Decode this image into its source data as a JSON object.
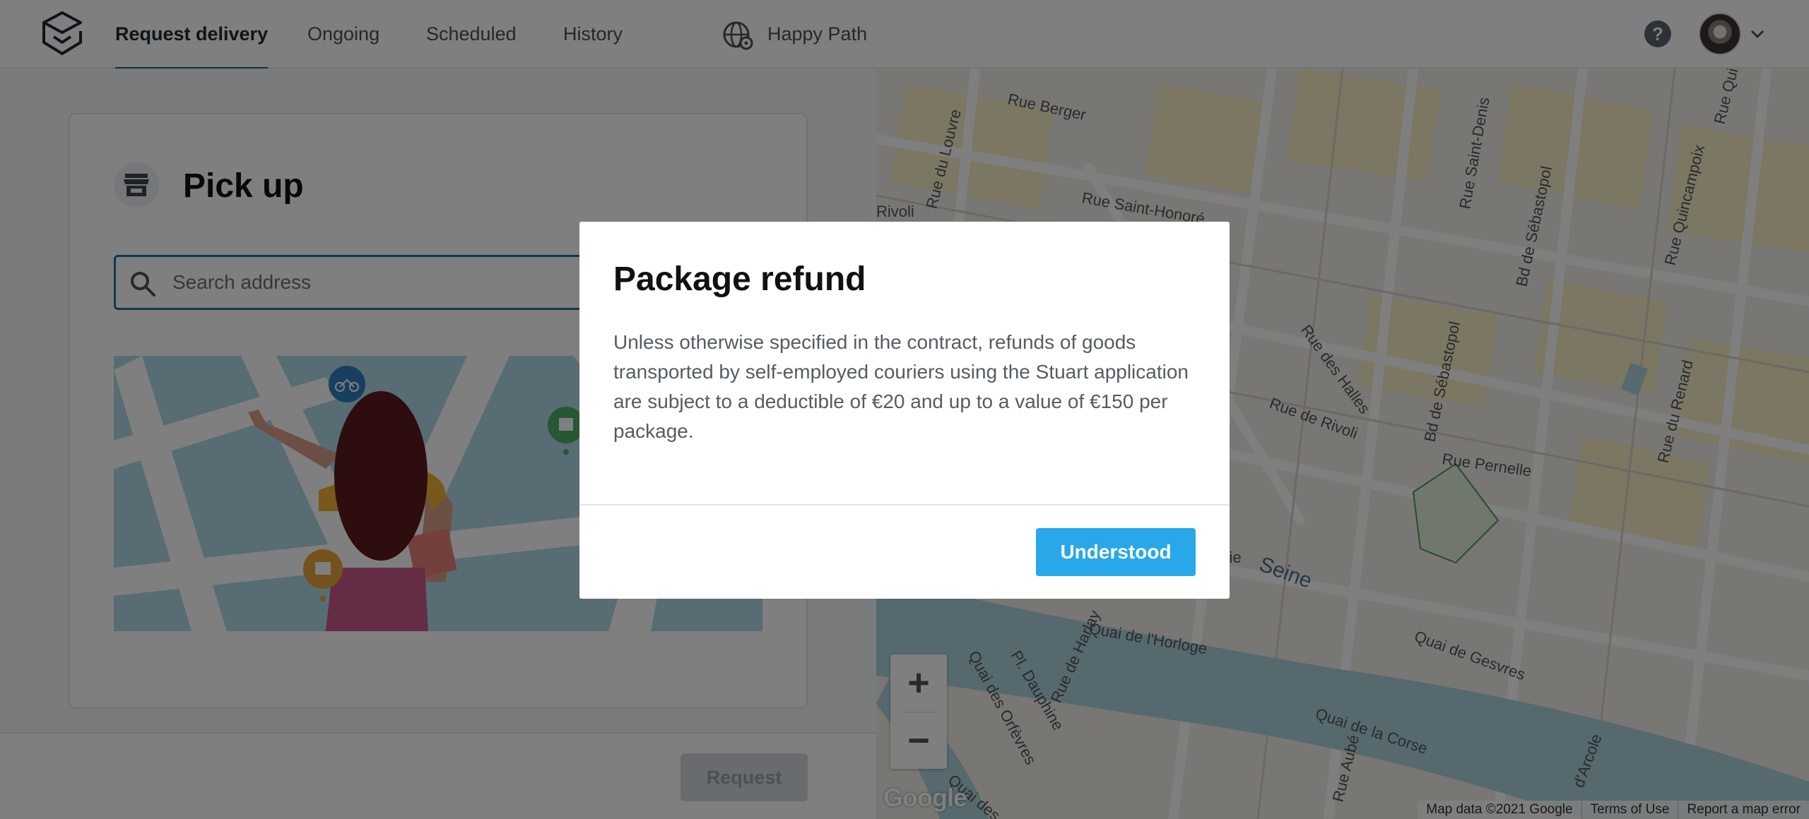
{
  "nav": {
    "tabs": [
      {
        "label": "Request delivery",
        "active": true
      },
      {
        "label": "Ongoing",
        "active": false
      },
      {
        "label": "Scheduled",
        "active": false
      },
      {
        "label": "History",
        "active": false
      }
    ],
    "account_label": "Happy Path",
    "help_label": "?"
  },
  "pickup": {
    "title": "Pick up",
    "search_placeholder": "Search address"
  },
  "footer": {
    "request_label": "Request"
  },
  "map": {
    "zoom_in": "+",
    "zoom_out": "−",
    "google_label": "Google",
    "attribution": [
      "Map data ©2021 Google",
      "Terms of Use",
      "Report a map error"
    ],
    "street_labels": [
      "Rue Berger",
      "Rue du Louvre",
      "Rue Saint-Honoré",
      "Rivoli",
      "Rue Saint-Denis",
      "Bd de Sébastopol",
      "Rue Quincampoix",
      "Rue Quin",
      "Rue des Halles",
      "Rue de Rivoli",
      "Bd de Sébastopol",
      "Rue Pernelle",
      "Rue du Renard",
      "Seine",
      "Quai de Gesvres",
      "Quai de l'Horloge",
      "Quai des Orfèvres",
      "Pl. Dauphine",
      "Rue de Harlay",
      "Quai de la Corse",
      "Rue Aubé",
      "d'Arcole",
      "Quai des",
      "erie"
    ]
  },
  "modal": {
    "title": "Package refund",
    "body": "Unless otherwise specified in the contract, refunds of goods transported by self-employed couriers using the Stuart application are subject to a deductible of €20 and up to a value of €150 per package.",
    "button_label": "Understood"
  },
  "colors": {
    "nav_active_underline": "#1f5c82",
    "search_border": "#1f6fa3",
    "primary_button": "#28a8e8",
    "water": "#aad3df",
    "map_block": "#f5f0c8"
  }
}
